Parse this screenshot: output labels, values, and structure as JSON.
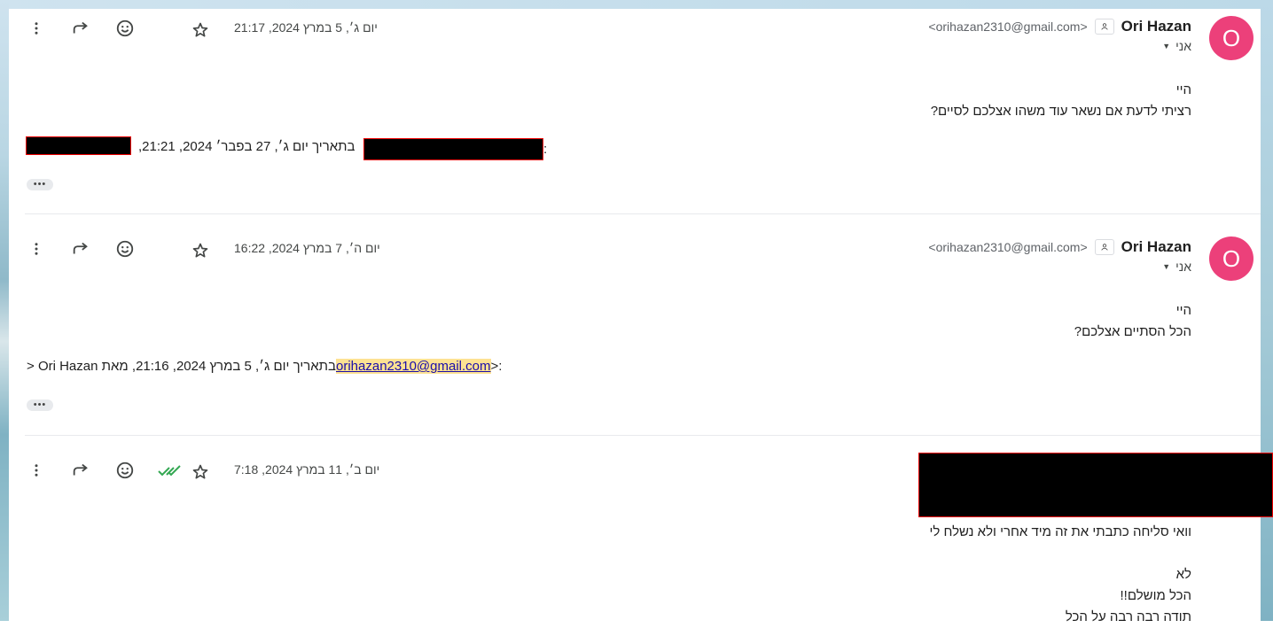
{
  "messages": [
    {
      "sender_name": "Ori Hazan",
      "sender_email": "<orihazan2310@gmail.com>",
      "to_label": "אני",
      "date": "יום ג׳, 5 במרץ 2024, 21:17",
      "avatar_letter": "O",
      "body": [
        "היי",
        "רציתי לדעת אם נשאר עוד משהו אצלכם לסיים?"
      ],
      "quote_header": ":‎<‎בתאריך יום ג׳, 27 בפבר׳ 2024, 21:21, ",
      "quote_text_a": "בתאריך יום ג׳, 27 בפבר׳ 2024, 21:21,",
      "ellipsis": "•••"
    },
    {
      "sender_name": "Ori Hazan",
      "sender_email": "<orihazan2310@gmail.com>",
      "to_label": "אני",
      "date": "יום ה׳, 7 במרץ 2024, 16:22",
      "avatar_letter": "O",
      "body": [
        "היי",
        "הכל הסתיים אצלכם?"
      ],
      "quote_prefix": "בתאריך יום ג׳, 5 במרץ 2024, 21:16, מאת Ori Hazan <",
      "quote_email": "orihazan2310@gmail.com",
      "quote_suffix": ">:",
      "ellipsis": "•••"
    },
    {
      "date": "יום ב׳, 11 במרץ 2024, 7:18",
      "body": [
        "וואי סליחה כתבתי את זה מיד אחרי ולא נשלח לי",
        "",
        "לא",
        "הכל מושלם!!",
        "תודה רבה רבה על הכל"
      ]
    }
  ],
  "colors": {
    "avatar": "#ec407a",
    "highlight": "#fde293",
    "read_check": "#34a853",
    "redaction_border": "#e00000"
  },
  "icons": [
    "more-vert-icon",
    "forward-icon",
    "emoji-icon",
    "star-icon",
    "double-check-icon",
    "contact-card-icon",
    "caret-down-icon"
  ]
}
